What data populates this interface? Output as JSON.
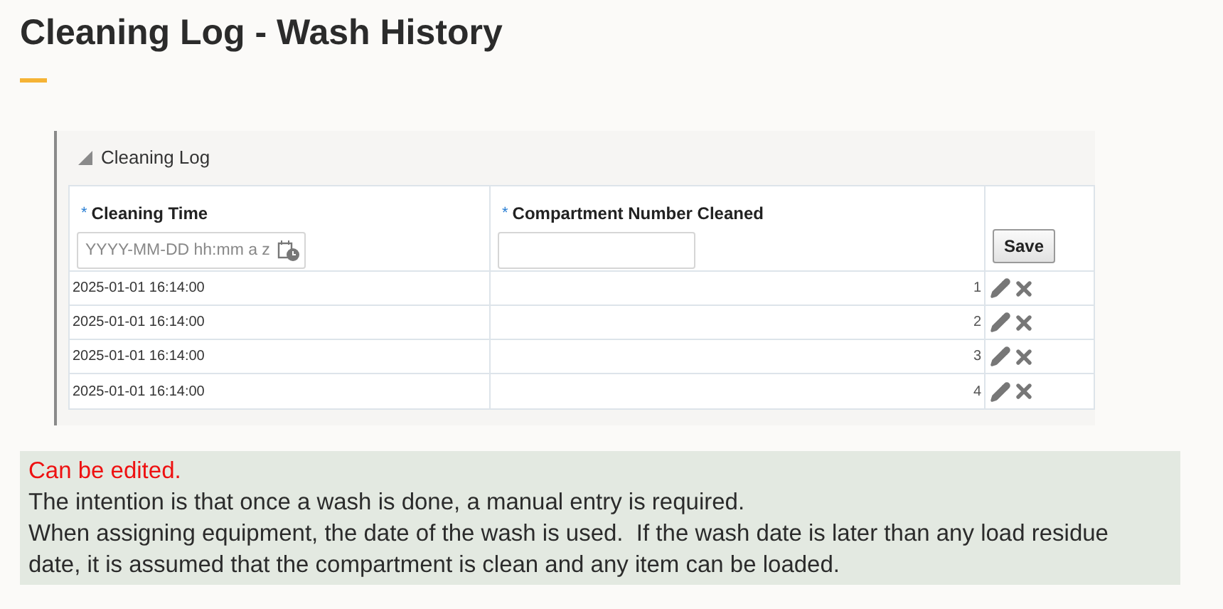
{
  "page_title": "Cleaning Log - Wash History",
  "panel": {
    "title": "Cleaning Log",
    "expanded": true
  },
  "table": {
    "columns": [
      {
        "label": "Cleaning Time",
        "required_mark": "*",
        "placeholder": "YYYY-MM-DD hh:mm a z"
      },
      {
        "label": "Compartment Number Cleaned",
        "required_mark": "*"
      }
    ],
    "save_button": "Save",
    "rows": [
      {
        "time": "2025-01-01 16:14:00",
        "number": "1"
      },
      {
        "time": "2025-01-01 16:14:00",
        "number": "2"
      },
      {
        "time": "2025-01-01 16:14:00",
        "number": "3"
      },
      {
        "time": "2025-01-01 16:14:00",
        "number": "4"
      }
    ]
  },
  "note": {
    "heading": "Can be edited.",
    "paragraphs": [
      "The intention is that once a wash is done, a manual entry is required.",
      "When assigning equipment, the date of the wash is used.  If the wash date is later than any load residue date, it is assumed that the compartment is clean and any item can be loaded."
    ]
  }
}
